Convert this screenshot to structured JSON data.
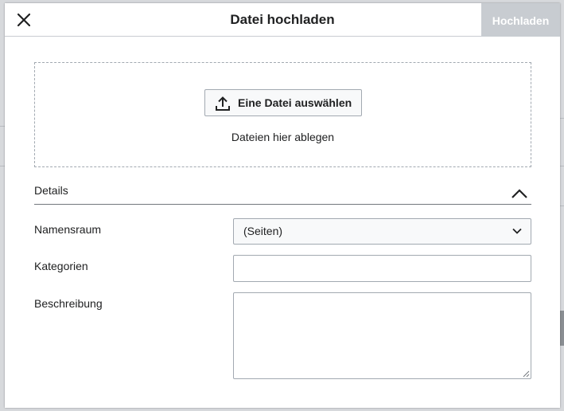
{
  "dialog": {
    "title": "Datei hochladen",
    "primary_action_label": "Hochladen",
    "close_icon": "close-icon"
  },
  "dropzone": {
    "select_button_label": "Eine Datei auswählen",
    "select_button_icon": "upload-icon",
    "hint": "Dateien hier ablegen"
  },
  "details": {
    "label": "Details",
    "toggle_icon": "chevron-up-icon",
    "fields": {
      "namespace": {
        "label": "Namensraum",
        "value": "(Seiten)",
        "icon": "chevron-down-icon"
      },
      "categories": {
        "label": "Kategorien",
        "value": ""
      },
      "description": {
        "label": "Beschreibung",
        "value": ""
      }
    }
  },
  "colors": {
    "primary_disabled_bg": "#c8ccd1",
    "border": "#a2a9b1",
    "text": "#202122"
  }
}
